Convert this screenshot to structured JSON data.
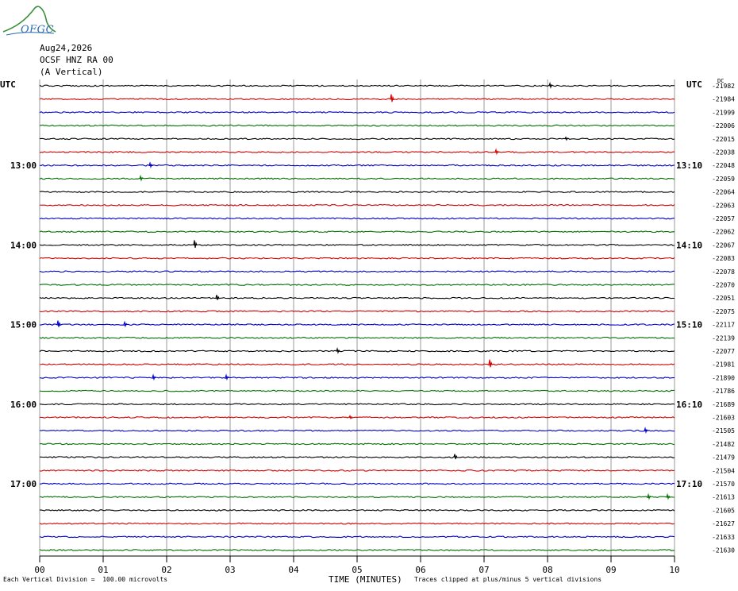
{
  "logo": {
    "text": "OFGC"
  },
  "header": {
    "date": "Aug24,2026",
    "station": "OCSF HNZ RA 00",
    "component": "(A Vertical)"
  },
  "axis": {
    "left_utc_label": "UTC",
    "right_utc_label": "UTC",
    "dc_label": "DC",
    "x_title": "TIME (MINUTES)"
  },
  "footer": {
    "scale_note": "Each Vertical Division =  100.00 microvolts",
    "clip_note": "Traces clipped at plus/minus 5 vertical divisions"
  },
  "colors": {
    "trace_cycle": [
      "#000000",
      "#d00000",
      "#0000c8",
      "#007000"
    ],
    "grid": "#808080"
  },
  "chart_data": {
    "type": "line",
    "title": "",
    "xlabel": "TIME (MINUTES)",
    "xlim": [
      0,
      10
    ],
    "x_ticks": [
      "00",
      "01",
      "02",
      "03",
      "04",
      "05",
      "06",
      "07",
      "08",
      "09",
      "10"
    ],
    "left_hour_labels": [
      {
        "row": 6,
        "label": "13:00"
      },
      {
        "row": 12,
        "label": "14:00"
      },
      {
        "row": 18,
        "label": "15:00"
      },
      {
        "row": 24,
        "label": "16:00"
      },
      {
        "row": 30,
        "label": "17:00"
      }
    ],
    "right_hour_labels": [
      {
        "row": 6,
        "label": "13:10"
      },
      {
        "row": 12,
        "label": "14:10"
      },
      {
        "row": 18,
        "label": "15:10"
      },
      {
        "row": 24,
        "label": "16:10"
      },
      {
        "row": 30,
        "label": "17:10"
      }
    ],
    "dc_offsets": [
      -21982,
      -21984,
      -21999,
      -22006,
      -22015,
      -22038,
      -22048,
      -22059,
      -22064,
      -22063,
      -22057,
      -22062,
      -22067,
      -22083,
      -22078,
      -22070,
      -22051,
      -22075,
      -22117,
      -22139,
      -22077,
      -21981,
      -21890,
      -21786,
      -21689,
      -21603,
      -21505,
      -21482,
      -21479,
      -21504,
      -21570,
      -21613,
      -21605,
      -21627,
      -21633,
      -21630
    ],
    "spikes": [
      {
        "row": 0,
        "minute": 8.05,
        "amp": 3
      },
      {
        "row": 1,
        "minute": 5.55,
        "amp": 6
      },
      {
        "row": 4,
        "minute": 8.3,
        "amp": 2
      },
      {
        "row": 5,
        "minute": 7.2,
        "amp": 3
      },
      {
        "row": 6,
        "minute": 1.75,
        "amp": 3
      },
      {
        "row": 7,
        "minute": 1.6,
        "amp": 3
      },
      {
        "row": 12,
        "minute": 2.45,
        "amp": 6
      },
      {
        "row": 16,
        "minute": 2.8,
        "amp": 4
      },
      {
        "row": 18,
        "minute": 0.3,
        "amp": 5
      },
      {
        "row": 18,
        "minute": 1.35,
        "amp": 3
      },
      {
        "row": 20,
        "minute": 4.7,
        "amp": 3
      },
      {
        "row": 21,
        "minute": 7.1,
        "amp": 6
      },
      {
        "row": 22,
        "minute": 1.8,
        "amp": 3
      },
      {
        "row": 22,
        "minute": 2.95,
        "amp": 3
      },
      {
        "row": 25,
        "minute": 4.9,
        "amp": 2
      },
      {
        "row": 26,
        "minute": 9.55,
        "amp": 3
      },
      {
        "row": 28,
        "minute": 6.55,
        "amp": 4
      },
      {
        "row": 31,
        "minute": 9.9,
        "amp": 3
      },
      {
        "row": 31,
        "minute": 9.6,
        "amp": 3
      }
    ]
  }
}
